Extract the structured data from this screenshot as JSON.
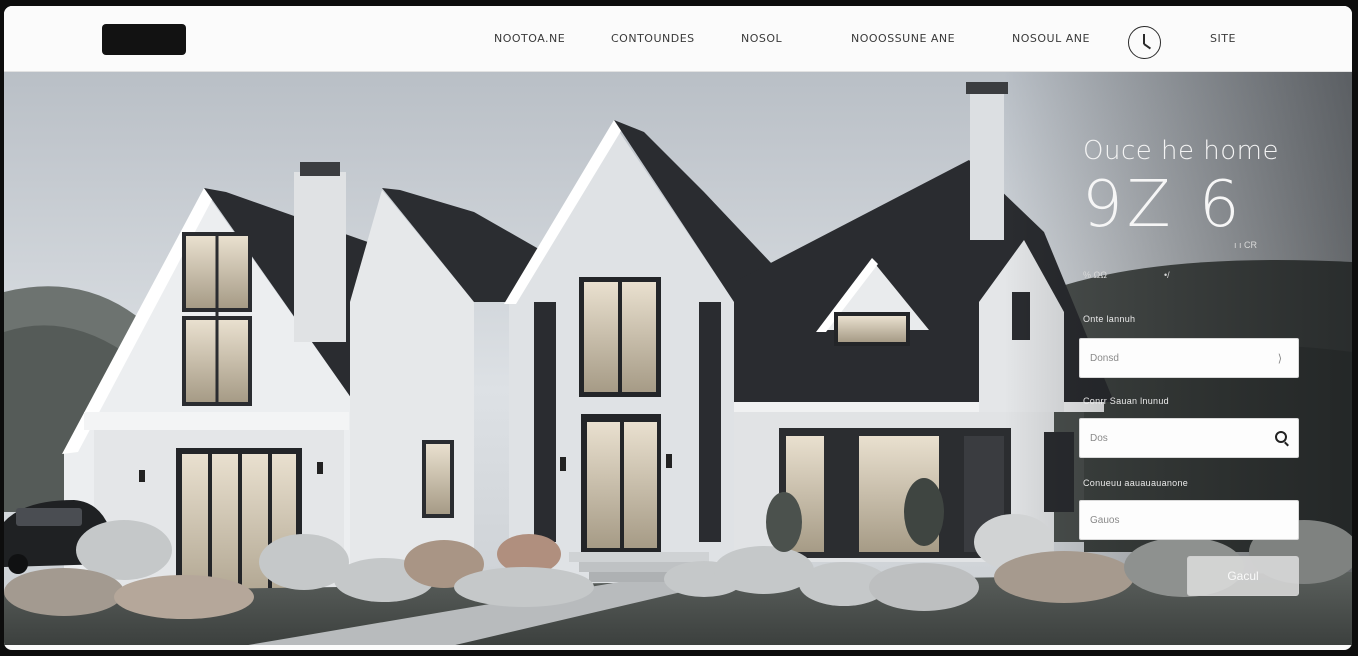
{
  "nav": {
    "links": [
      "NOOTOA.NE",
      "CONTOUNDES",
      "NOSOL",
      "NOOOSSUNE ANE",
      "NOSOUL ANE",
      "SITE"
    ]
  },
  "hero": {
    "title": "Ouce he home",
    "big_number": "9Z 6",
    "stat_right": "ı ı CR",
    "stat_left": "% ΩΩ",
    "stat_mid": "•/"
  },
  "form": {
    "label_1": "Onte lannuh",
    "field_1_placeholder": "Donsd",
    "field_1_chevron": "⟩",
    "label_2": "Conrr Sauan lnunud",
    "field_2_placeholder": "Dos",
    "label_3": "Conueuu aauauauanone",
    "field_3_placeholder": "Gauos",
    "submit_label": "Gacul"
  },
  "icons": {
    "nav_action": "clock-icon",
    "field_search": "search-icon",
    "field_select": "chevron-right-icon"
  },
  "colors": {
    "nav_bg": "#fbfbfb",
    "logo": "#121212",
    "roof": "#2a2c30",
    "wall": "#eceef0",
    "lawn": "#454a47"
  }
}
